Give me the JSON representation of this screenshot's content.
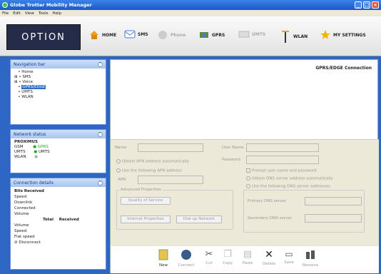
{
  "window": {
    "title": "Globe Trotter Mobility Manager"
  },
  "menu": [
    "File",
    "Edit",
    "View",
    "Tools",
    "Help"
  ],
  "logo": "OPTION",
  "toolbar": {
    "home": "HOME",
    "sms": "SMS",
    "phone": "Phone",
    "gprs": "GPRS",
    "umts": "UMTS",
    "wlan": "WLAN",
    "my_settings": "MY SETTINGS"
  },
  "nav": {
    "title": "Navigation bar",
    "items": [
      "Home",
      "SMS",
      "Voice",
      "GPRS/EDGE",
      "UMTS",
      "WLAN"
    ]
  },
  "netstatus": {
    "title": "Network status",
    "operator": "PROXIMUS",
    "rows": [
      {
        "k": "GSM",
        "v": "GPRS"
      },
      {
        "k": "UMTS",
        "v": "UMTS"
      },
      {
        "k": "WLAN",
        "v": ""
      }
    ]
  },
  "conn": {
    "title": "Connection details",
    "lines": [
      "Bits Received",
      "Speed",
      "Downlink",
      "Connected",
      "Volume"
    ],
    "cols": [
      "Total",
      "Received"
    ],
    "rows": [
      "Volume",
      "Speed",
      "Flat speed"
    ],
    "disconnect": "Disconnect"
  },
  "main": {
    "header": "GPRS/EDGE Connection"
  },
  "form": {
    "name": "Name",
    "username": "User Name",
    "password": "Password",
    "obtain_apn": "Obtain APN address automatically",
    "use_apn": "Use the following APN address",
    "apn": "APN",
    "prompt": "Prompt user name and password",
    "obtain_dns": "Obtain DNS server address automatically",
    "use_dns": "Use the following DNS server addresses",
    "advanced": "Advanced Properties",
    "qos": "Quality of Service",
    "primary_dns": "Primary DNS server",
    "secondary_dns": "Secondary DNS server",
    "internet_props": "Internet Properties",
    "dialup": "Dial-up Network"
  },
  "bottom": {
    "new": "New",
    "connect": "Connect",
    "cut": "Cut",
    "copy": "Copy",
    "paste": "Paste",
    "delete": "Delete",
    "save": "Save",
    "remove": "Remove"
  },
  "colors": {
    "title": "#2a6ed6",
    "accent": "#316ac5"
  }
}
